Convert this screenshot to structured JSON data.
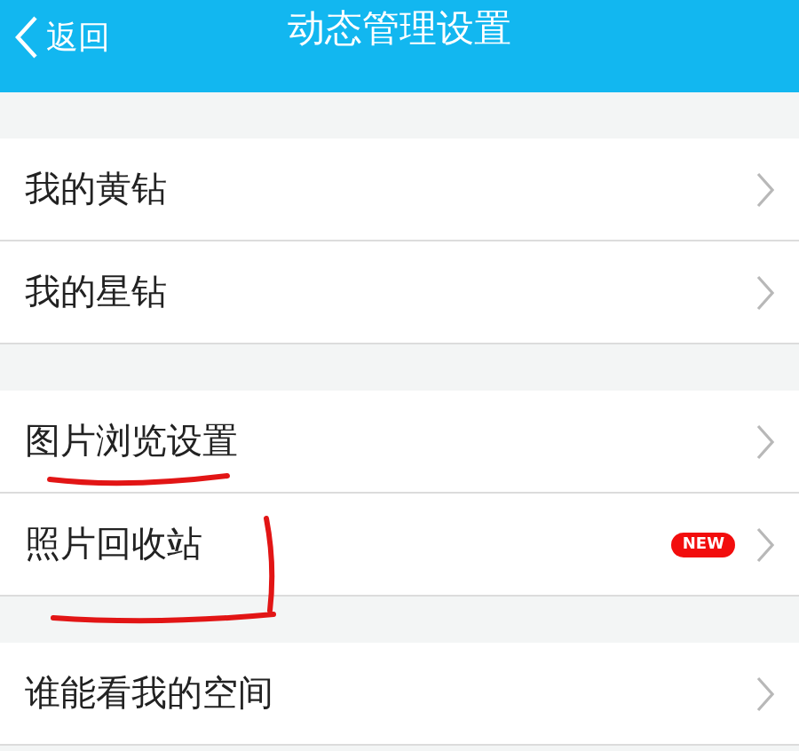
{
  "header": {
    "back": "返回",
    "title": "动态管理设置"
  },
  "groups": [
    {
      "items": [
        {
          "label": "我的黄钻"
        },
        {
          "label": "我的星钻"
        }
      ]
    },
    {
      "items": [
        {
          "label": "图片浏览设置"
        },
        {
          "label": "照片回收站",
          "badge": "NEW"
        }
      ]
    },
    {
      "items": [
        {
          "label": "谁能看我的空间"
        }
      ]
    }
  ]
}
